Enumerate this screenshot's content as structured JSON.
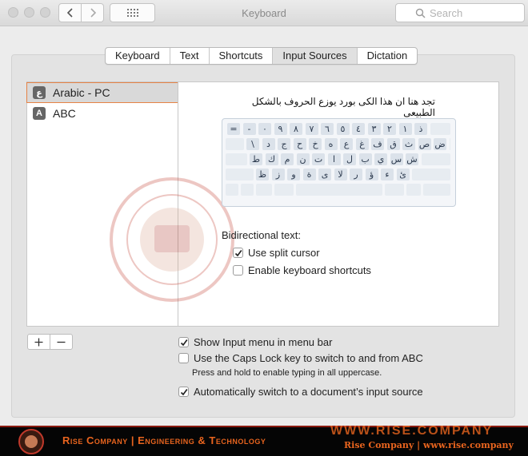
{
  "window": {
    "title": "Keyboard",
    "search_placeholder": "Search"
  },
  "tabs": [
    "Keyboard",
    "Text",
    "Shortcuts",
    "Input Sources",
    "Dictation"
  ],
  "active_tab": "Input Sources",
  "input_sources": [
    {
      "icon_glyph": "ع",
      "label": "Arabic - PC",
      "selected": true
    },
    {
      "icon_glyph": "A",
      "label": "ABC",
      "selected": false
    }
  ],
  "detail": {
    "hint": "تجد هنا ان هذا الكى بورد يوزع الحروف بالشكل الطبيعى",
    "keyboard_rows": [
      [
        "ذ",
        "١",
        "٢",
        "٣",
        "٤",
        "٥",
        "٦",
        "٧",
        "٨",
        "٩",
        "٠",
        "-",
        "="
      ],
      [
        "ض",
        "ص",
        "ث",
        "ق",
        "ف",
        "غ",
        "ع",
        "ه",
        "خ",
        "ح",
        "ج",
        "د",
        "\\"
      ],
      [
        "ش",
        "س",
        "ي",
        "ب",
        "ل",
        "ا",
        "ت",
        "ن",
        "م",
        "ك",
        "ط"
      ],
      [
        "ئ",
        "ء",
        "ؤ",
        "ر",
        "لا",
        "ى",
        "ة",
        "و",
        "ز",
        "ظ"
      ]
    ],
    "bidi_label": "Bidirectional text:",
    "use_split_cursor": {
      "label": "Use split cursor",
      "checked": true
    },
    "enable_shortcuts": {
      "label": "Enable keyboard shortcuts",
      "checked": false
    }
  },
  "list_controls": {
    "add": "+",
    "remove": "−"
  },
  "options": {
    "show_input_menu": {
      "label": "Show Input menu in menu bar",
      "checked": true
    },
    "caps_lock": {
      "label": "Use the Caps Lock key to switch to and from ABC",
      "checked": false,
      "note": "Press and hold to enable typing in all uppercase."
    },
    "auto_switch": {
      "label": "Automatically switch to a document’s input source",
      "checked": true
    }
  },
  "footer": {
    "text": "Rise Company | Engineering & Technology",
    "url_large": "WWW.RISE.COMPANY",
    "url_small": "Rise Company | www.rise.company"
  },
  "colors": {
    "selection_border": "#e68346",
    "brand_orange": "#e8641e"
  }
}
